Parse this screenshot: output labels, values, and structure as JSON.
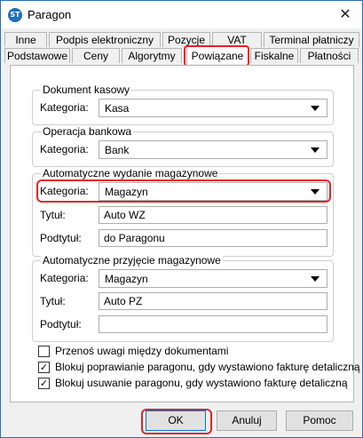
{
  "window": {
    "title": "Paragon",
    "app_icon_text": "ST"
  },
  "tabs_row1": [
    "Inne",
    "Podpis elektroniczny",
    "Pozycje",
    "VAT",
    "Terminal płatniczy"
  ],
  "tabs_row2": [
    "Podstawowe",
    "Ceny",
    "Algorytmy",
    "Powiązane",
    "Fiskalne",
    "Płatności"
  ],
  "active_tab": "Powiązane",
  "groups": {
    "dokument_kasowy": {
      "title": "Dokument kasowy",
      "kategoria_label": "Kategoria:",
      "kategoria_value": "Kasa"
    },
    "operacja_bankowa": {
      "title": "Operacja bankowa",
      "kategoria_label": "Kategoria:",
      "kategoria_value": "Bank"
    },
    "wydanie": {
      "title": "Automatyczne wydanie magazynowe",
      "kategoria_label": "Kategoria:",
      "kategoria_value": "Magazyn",
      "tytul_label": "Tytuł:",
      "tytul_value": "Auto WZ",
      "podtytul_label": "Podtytuł:",
      "podtytul_value": "do Paragonu"
    },
    "przyjecie": {
      "title": "Automatyczne przyjęcie magazynowe",
      "kategoria_label": "Kategoria:",
      "kategoria_value": "Magazyn",
      "tytul_label": "Tytuł:",
      "tytul_value": "Auto PZ",
      "podtytul_label": "Podtytuł:",
      "podtytul_value": ""
    }
  },
  "checkboxes": [
    {
      "label": "Przenoś uwagi między dokumentami",
      "checked": false
    },
    {
      "label": "Blokuj poprawianie paragonu, gdy wystawiono fakturę detaliczną",
      "checked": true
    },
    {
      "label": "Blokuj usuwanie paragonu, gdy wystawiono fakturę detaliczną",
      "checked": true
    }
  ],
  "buttons": {
    "ok": "OK",
    "cancel": "Anuluj",
    "help": "Pomoc"
  },
  "colors": {
    "highlight": "#e0242b",
    "focus": "#0078d7"
  }
}
